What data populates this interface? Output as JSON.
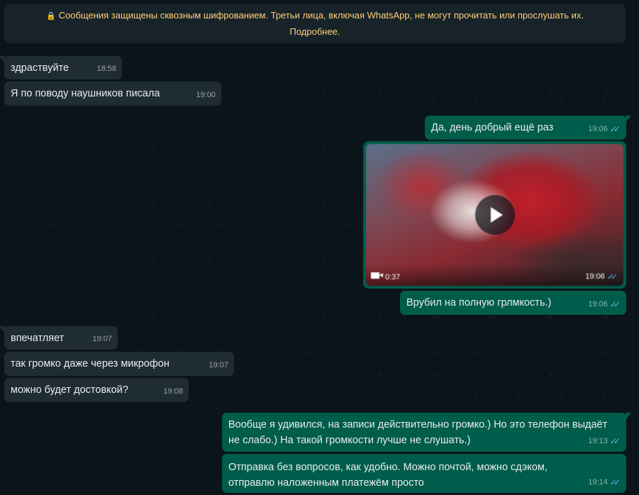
{
  "encryption_notice": {
    "line1": "Сообщения защищены сквозным шифрованием. Третьи лица, включая WhatsApp, не могут прочитать или прослушать их.",
    "link": "Подробнее."
  },
  "messages": [
    {
      "direction": "in",
      "text": "здраствуйте",
      "time": "18:58"
    },
    {
      "direction": "in",
      "text": "Я по поводу наушников писала",
      "time": "19:00"
    },
    {
      "direction": "out",
      "text": "Да, день добрый ещё раз",
      "time": "19:06",
      "status": "read"
    },
    {
      "direction": "out",
      "type": "video",
      "duration": "0:37",
      "time": "19:06",
      "status": "read"
    },
    {
      "direction": "out",
      "text": "Врубил на полную грлмкость.)",
      "time": "19:06",
      "status": "read"
    },
    {
      "direction": "in",
      "text": "впечатляет",
      "time": "19:07"
    },
    {
      "direction": "in",
      "text": "так громко даже через микрофон",
      "time": "19:07"
    },
    {
      "direction": "in",
      "text": "можно будет достовкой?",
      "time": "19:08"
    },
    {
      "direction": "out",
      "text": "Вообще я удивился, на записи действительно громко.) Но это телефон выдаёт не слабо.) На такой громкости лучше не слушать.)",
      "time": "19:13",
      "status": "read"
    },
    {
      "direction": "out",
      "text": "Отправка без вопросов, как удобно. Можно почтой, можно сдэком, отправлю наложенным платежём просто",
      "time": "19:14",
      "status": "read"
    }
  ],
  "icons": {
    "lock": "lock-icon",
    "read_receipt": "double-check-icon",
    "play": "play-icon",
    "video": "video-camera-icon"
  },
  "colors": {
    "background": "#0b141a",
    "incoming_bubble": "#202c33",
    "outgoing_bubble": "#005c4b",
    "notice_text": "#ffd279",
    "read_ticks": "#53bdeb"
  }
}
